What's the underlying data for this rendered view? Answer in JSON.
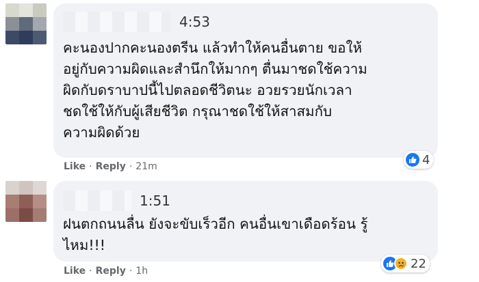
{
  "comments": [
    {
      "time": "4:53",
      "lines": [
        "คะนองปากคะนองตรีน แล้วทำให้คนอื่นตาย ขอให้",
        "อยู่กับความผิดและสำนึกให้มากๆ ตื่นมาชดใช้ความ",
        "ผิดกับดราบาปนี้ไปตลอดชีวิตนะ อวยรวยนักเวลา",
        "ชดใช้ให้กับผู้เสียชีวิต กรุณาชดใช้ให้สาสมกับ",
        "ความผิดด้วย"
      ],
      "like": "Like",
      "reply": "Reply",
      "age": "21m",
      "reaction_count": "4",
      "reactions": [
        "like-icon"
      ]
    },
    {
      "time": "1:51",
      "lines": [
        "ฝนตกถนนลื่น ยังจะขับเร็วอีก คนอื่นเขาเดือดร้อน รู้",
        "ไหม!!!"
      ],
      "like": "Like",
      "reply": "Reply",
      "age": "1h",
      "reaction_count": "22",
      "reactions": [
        "like-icon",
        "sad-icon"
      ]
    }
  ],
  "colors": {
    "like_blue": "#1877f2",
    "sad_yellow": "#f7b125",
    "bubble_bg": "#f0f2f5"
  }
}
